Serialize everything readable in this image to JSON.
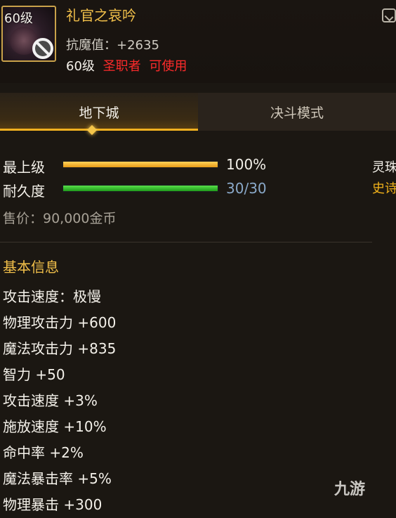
{
  "item": {
    "icon_level": "60级",
    "name": "礼官之哀吟",
    "resist": "抗魔值：+2635",
    "req_level": "60级",
    "req_class": "圣职者",
    "req_use": "可使用"
  },
  "tabs": [
    {
      "label": "地下城"
    },
    {
      "label": "决斗模式"
    }
  ],
  "bars": {
    "grade": {
      "label": "最上级",
      "value_text": "100%",
      "fill": 1.0
    },
    "durability": {
      "label": "耐久度",
      "value_text": "30/30",
      "fill": 1.0
    }
  },
  "side": {
    "line1": "灵珠",
    "line2": "史诗"
  },
  "price": "售价：90,000金币",
  "basic_info": {
    "title": "基本信息",
    "lines": [
      "攻击速度：极慢",
      "物理攻击力 +600",
      "魔法攻击力 +835",
      "智力 +50",
      "攻击速度 +3%",
      "施放速度 +10%",
      "命中率 +2%",
      "魔法暴击率 +5%",
      "物理暴击 +300"
    ]
  },
  "watermark": "九游",
  "colors": {
    "gold": "#f2c04a",
    "red": "#ff2b2b",
    "green": "#2fbf2a"
  }
}
